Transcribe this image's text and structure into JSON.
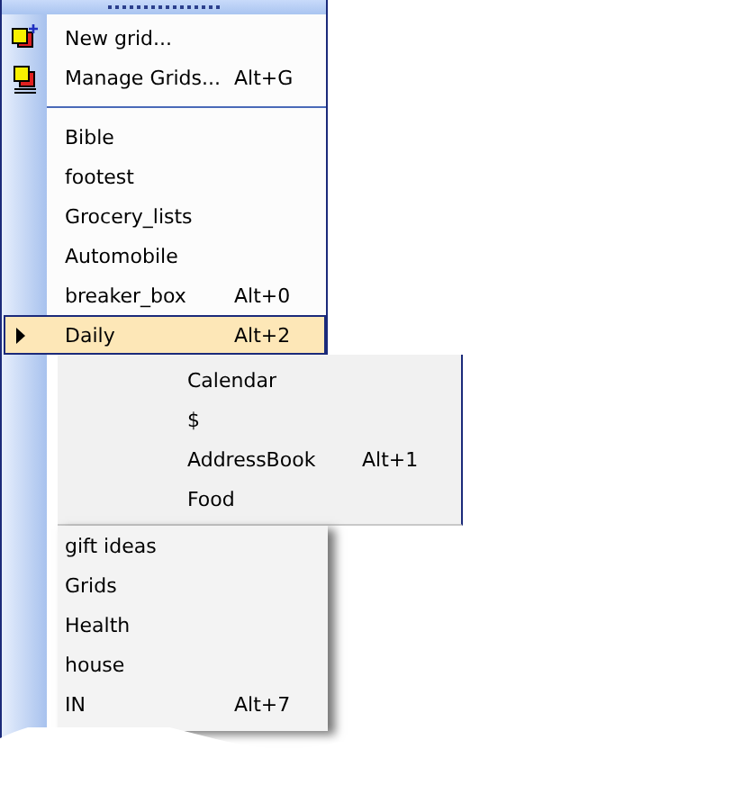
{
  "menu": {
    "commands": [
      {
        "label": "New grid..."
      },
      {
        "label": "Manage Grids...",
        "shortcut": "Alt+G"
      }
    ],
    "grids": [
      {
        "label": "Bible",
        "selected": false
      },
      {
        "label": "footest",
        "selected": false
      },
      {
        "label": "Grocery_lists",
        "selected": false
      },
      {
        "label": "Automobile",
        "selected": false
      },
      {
        "label": "breaker_box",
        "shortcut": "Alt+0",
        "selected": false
      },
      {
        "label": "Daily",
        "shortcut": "Alt+2",
        "selected": true,
        "children": [
          {
            "label": "Calendar"
          },
          {
            "label": "$"
          },
          {
            "label": "AddressBook",
            "shortcut": "Alt+1"
          },
          {
            "label": "Food"
          }
        ]
      },
      {
        "label": "gift ideas",
        "selected": false
      },
      {
        "label": "Grids",
        "selected": false
      },
      {
        "label": "Health",
        "selected": false
      },
      {
        "label": "house",
        "selected": false
      },
      {
        "label": "IN",
        "shortcut": "Alt+7",
        "selected": false
      }
    ]
  }
}
